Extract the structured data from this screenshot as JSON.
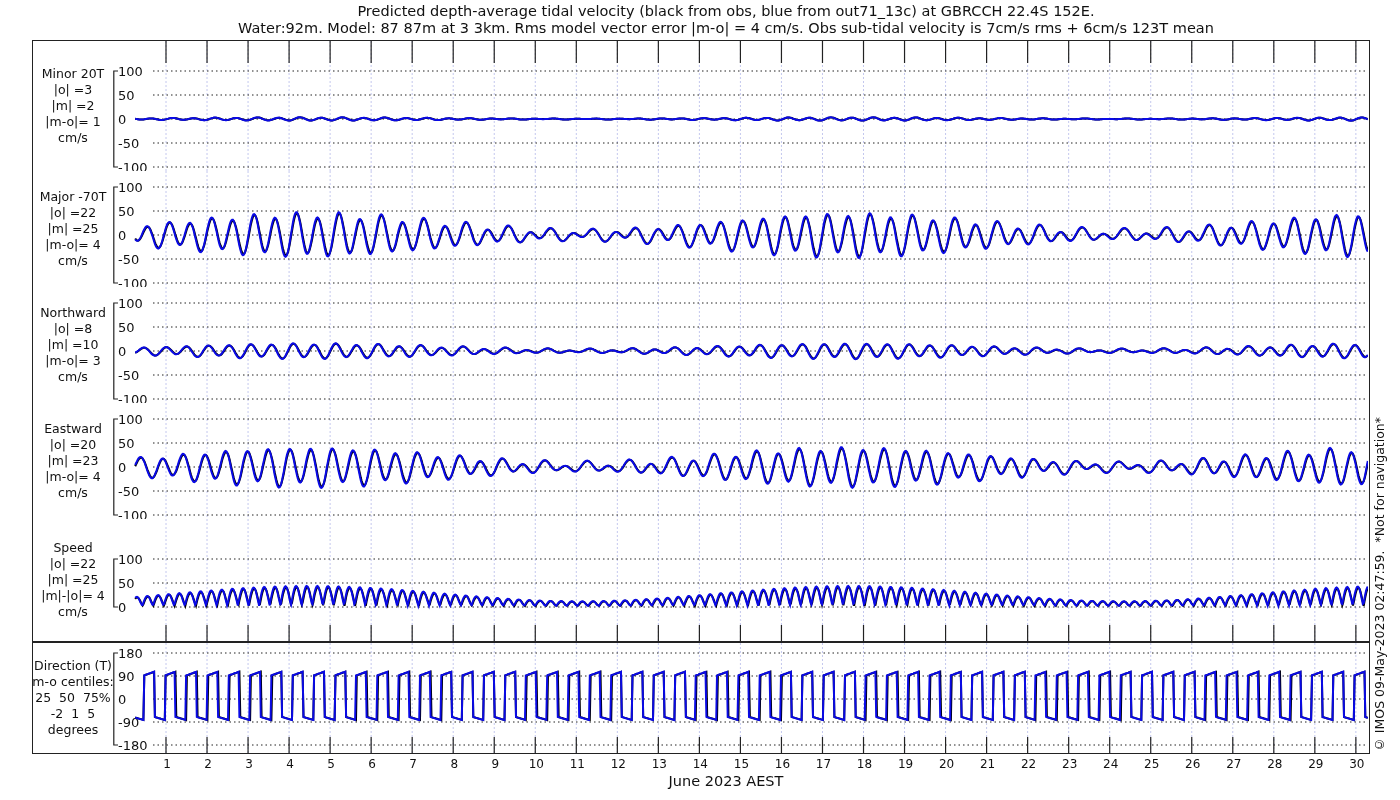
{
  "title_lines": [
    "Predicted depth-average tidal velocity (black from obs, blue from out71_13c) at GBRCCH 22.4S 152E.",
    "Water:92m. Model: 87 87m at 3 3km. Rms model vector error |m-o| = 4 cm/s. Obs sub-tidal velocity is 7cm/s rms + 6cm/s 123T mean"
  ],
  "upper_panels": [
    {
      "kind": "velocity",
      "label_lines": [
        "Minor 20T",
        "|o| =3",
        "|m| =2",
        "|m-o|= 1",
        "cm/s"
      ],
      "yticks": [
        "100",
        "50",
        "0",
        "-50",
        "-100"
      ]
    },
    {
      "kind": "velocity",
      "label_lines": [
        "Major -70T",
        "|o| =22",
        "|m| =25",
        "|m-o|= 4",
        "cm/s"
      ],
      "yticks": [
        "100",
        "50",
        "0",
        "-50",
        "-100"
      ]
    },
    {
      "kind": "velocity",
      "label_lines": [
        "Northward",
        "|o| =8",
        "|m| =10",
        "|m-o|= 3",
        "cm/s"
      ],
      "yticks": [
        "100",
        "50",
        "0",
        "-50",
        "-100"
      ]
    },
    {
      "kind": "velocity",
      "label_lines": [
        "Eastward",
        "|o| =20",
        "|m| =23",
        "|m-o|= 4",
        "cm/s"
      ],
      "yticks": [
        "100",
        "50",
        "0",
        "-50",
        "-100"
      ]
    },
    {
      "kind": "speed",
      "label_lines": [
        "Speed",
        "|o| =22",
        "|m| =25",
        "|m|-|o|= 4",
        "cm/s"
      ],
      "yticks": [
        "100",
        "50",
        "0"
      ]
    }
  ],
  "lower_panels": [
    {
      "kind": "direction",
      "label_lines": [
        "Direction (T)",
        "m-o centiles:",
        "25  50  75%",
        "-2  1  5",
        "degrees"
      ],
      "yticks": [
        "180",
        "90",
        "0",
        "-90",
        "-180"
      ]
    }
  ],
  "x_ticks": [
    "1",
    "2",
    "3",
    "4",
    "5",
    "6",
    "7",
    "8",
    "9",
    "10",
    "11",
    "12",
    "13",
    "14",
    "15",
    "16",
    "17",
    "18",
    "19",
    "20",
    "21",
    "22",
    "23",
    "24",
    "25",
    "26",
    "27",
    "28",
    "29",
    "30"
  ],
  "x_label": "June 2023 AEST",
  "side_note": "© IMOS 09-May-2023 02:47:59.  *Not for navigation*"
}
